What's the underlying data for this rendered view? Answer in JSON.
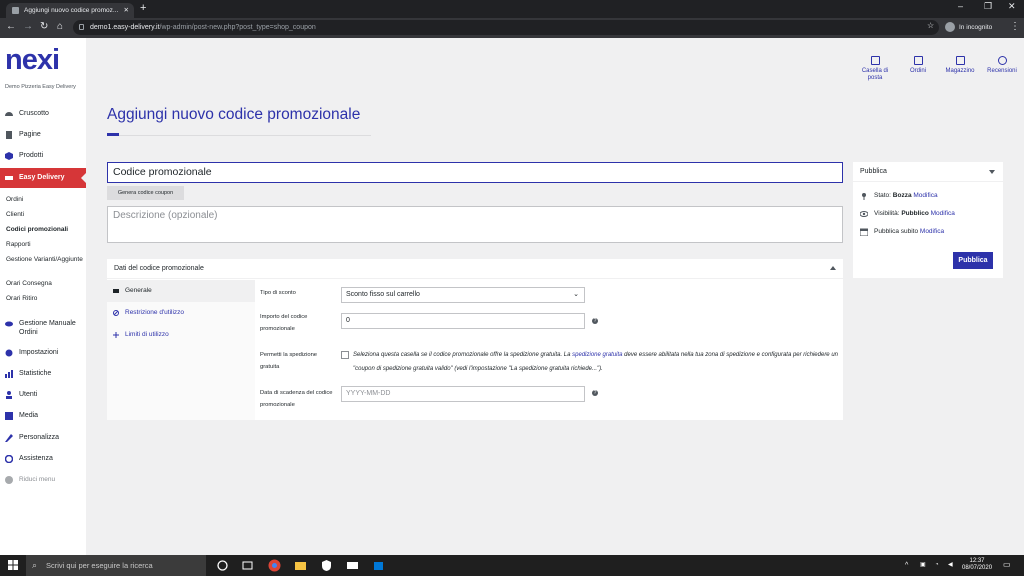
{
  "browser": {
    "tab_title": "Aggiungi nuovo codice promoz...",
    "tab_close": "✕",
    "new_tab": "+",
    "url_host": "demo1.easy-delivery.it",
    "url_path": "/wp-admin/post-new.php?post_type=shop_coupon",
    "incognito_label": "In incognito"
  },
  "sidebar": {
    "logo": "nexi",
    "site_name": "Demo Pizzeria Easy Delivery",
    "items": [
      {
        "label": "Cruscotto",
        "icon": "dashboard-icon"
      },
      {
        "label": "Pagine",
        "icon": "pages-icon"
      },
      {
        "label": "Prodotti",
        "icon": "products-icon"
      },
      {
        "label": "Easy Delivery",
        "icon": "easy-delivery-icon"
      }
    ],
    "subitems": [
      "Ordini",
      "Clienti",
      "Codici promozionali",
      "Rapporti",
      "Gestione Varianti/Aggiunte",
      "Orari Consegna",
      "Orari Ritiro"
    ],
    "items2": [
      {
        "label": "Gestione Manuale Ordini",
        "icon": "eye-icon"
      },
      {
        "label": "Impostazioni",
        "icon": "settings-icon"
      },
      {
        "label": "Statistiche",
        "icon": "stats-icon"
      },
      {
        "label": "Utenti",
        "icon": "users-icon"
      },
      {
        "label": "Media",
        "icon": "media-icon"
      },
      {
        "label": "Personalizza",
        "icon": "brush-icon"
      },
      {
        "label": "Assistenza",
        "icon": "help-icon"
      }
    ],
    "collapse": "Riduci menu"
  },
  "topbar": [
    {
      "label": "Casella di posta",
      "icon": "inbox-icon"
    },
    {
      "label": "Ordini",
      "icon": "orders-icon"
    },
    {
      "label": "Magazzino",
      "icon": "warehouse-icon"
    },
    {
      "label": "Recensioni",
      "icon": "star-icon"
    }
  ],
  "main": {
    "page_title": "Aggiungi nuovo codice promozionale",
    "code_value": "Codice promozionale",
    "generate_button": "Genera codice coupon",
    "description_placeholder": "Descrizione (opzionale)"
  },
  "coupon_data": {
    "heading": "Dati del codice promozionale",
    "tabs": [
      "Generale",
      "Restrizione d'utilizzo",
      "Limiti di utilizzo"
    ],
    "discount_type_label": "Tipo di sconto",
    "discount_type_value": "Sconto fisso sul carrello",
    "amount_label": "Importo del codice promozionale",
    "amount_value": "0",
    "free_shipping_label": "Permetti la spedizione gratuita",
    "free_shipping_text_1": "Seleziona questa casella se il codice promozionale offre la spedizione gratuita. La ",
    "free_shipping_link": "spedizione gratuita",
    "free_shipping_text_2": " deve essere abilitata nella tua zona di spedizione e configurata per richiedere un \"coupon di spedizione gratuita valido\" (vedi l'impostazione \"La spedizione gratuita richiede...\").",
    "expiry_label": "Data di scadenza del codice promozionale",
    "expiry_placeholder": "YYYY-MM-DD"
  },
  "publish": {
    "heading": "Pubblica",
    "status_label": "Stato: ",
    "status_value": "Bozza",
    "visibility_label": "Visibilità: ",
    "visibility_value": "Pubblico",
    "schedule_label": "Pubblica subito",
    "edit_link": "Modifica",
    "button": "Pubblica"
  },
  "taskbar": {
    "search_placeholder": "Scrivi qui per eseguire la ricerca",
    "time": "12:37",
    "date": "08/07/2020"
  },
  "colors": {
    "accent": "#2d32aa",
    "active_menu": "#d63638"
  }
}
